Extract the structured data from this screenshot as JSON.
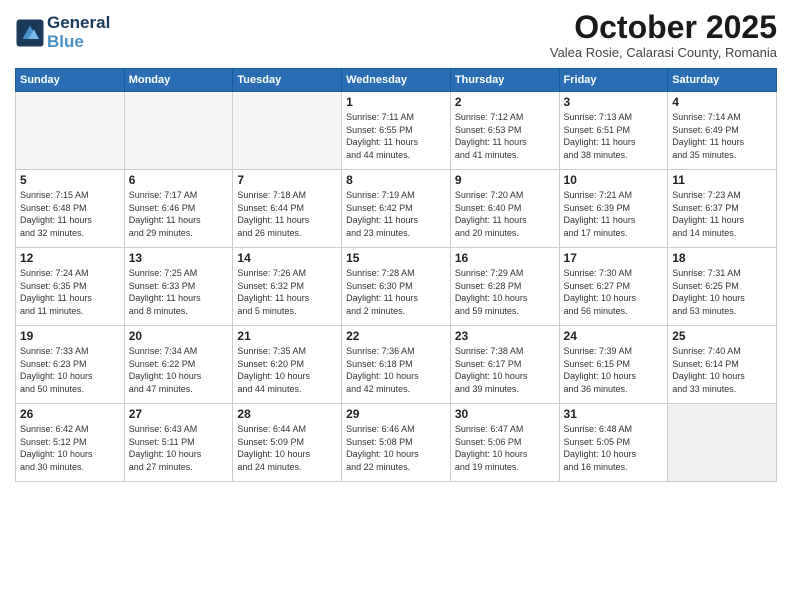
{
  "header": {
    "logo_line1": "General",
    "logo_line2": "Blue",
    "month": "October 2025",
    "location": "Valea Rosie, Calarasi County, Romania"
  },
  "days_of_week": [
    "Sunday",
    "Monday",
    "Tuesday",
    "Wednesday",
    "Thursday",
    "Friday",
    "Saturday"
  ],
  "weeks": [
    [
      {
        "day": "",
        "info": ""
      },
      {
        "day": "",
        "info": ""
      },
      {
        "day": "",
        "info": ""
      },
      {
        "day": "1",
        "info": "Sunrise: 7:11 AM\nSunset: 6:55 PM\nDaylight: 11 hours\nand 44 minutes."
      },
      {
        "day": "2",
        "info": "Sunrise: 7:12 AM\nSunset: 6:53 PM\nDaylight: 11 hours\nand 41 minutes."
      },
      {
        "day": "3",
        "info": "Sunrise: 7:13 AM\nSunset: 6:51 PM\nDaylight: 11 hours\nand 38 minutes."
      },
      {
        "day": "4",
        "info": "Sunrise: 7:14 AM\nSunset: 6:49 PM\nDaylight: 11 hours\nand 35 minutes."
      }
    ],
    [
      {
        "day": "5",
        "info": "Sunrise: 7:15 AM\nSunset: 6:48 PM\nDaylight: 11 hours\nand 32 minutes."
      },
      {
        "day": "6",
        "info": "Sunrise: 7:17 AM\nSunset: 6:46 PM\nDaylight: 11 hours\nand 29 minutes."
      },
      {
        "day": "7",
        "info": "Sunrise: 7:18 AM\nSunset: 6:44 PM\nDaylight: 11 hours\nand 26 minutes."
      },
      {
        "day": "8",
        "info": "Sunrise: 7:19 AM\nSunset: 6:42 PM\nDaylight: 11 hours\nand 23 minutes."
      },
      {
        "day": "9",
        "info": "Sunrise: 7:20 AM\nSunset: 6:40 PM\nDaylight: 11 hours\nand 20 minutes."
      },
      {
        "day": "10",
        "info": "Sunrise: 7:21 AM\nSunset: 6:39 PM\nDaylight: 11 hours\nand 17 minutes."
      },
      {
        "day": "11",
        "info": "Sunrise: 7:23 AM\nSunset: 6:37 PM\nDaylight: 11 hours\nand 14 minutes."
      }
    ],
    [
      {
        "day": "12",
        "info": "Sunrise: 7:24 AM\nSunset: 6:35 PM\nDaylight: 11 hours\nand 11 minutes."
      },
      {
        "day": "13",
        "info": "Sunrise: 7:25 AM\nSunset: 6:33 PM\nDaylight: 11 hours\nand 8 minutes."
      },
      {
        "day": "14",
        "info": "Sunrise: 7:26 AM\nSunset: 6:32 PM\nDaylight: 11 hours\nand 5 minutes."
      },
      {
        "day": "15",
        "info": "Sunrise: 7:28 AM\nSunset: 6:30 PM\nDaylight: 11 hours\nand 2 minutes."
      },
      {
        "day": "16",
        "info": "Sunrise: 7:29 AM\nSunset: 6:28 PM\nDaylight: 10 hours\nand 59 minutes."
      },
      {
        "day": "17",
        "info": "Sunrise: 7:30 AM\nSunset: 6:27 PM\nDaylight: 10 hours\nand 56 minutes."
      },
      {
        "day": "18",
        "info": "Sunrise: 7:31 AM\nSunset: 6:25 PM\nDaylight: 10 hours\nand 53 minutes."
      }
    ],
    [
      {
        "day": "19",
        "info": "Sunrise: 7:33 AM\nSunset: 6:23 PM\nDaylight: 10 hours\nand 50 minutes."
      },
      {
        "day": "20",
        "info": "Sunrise: 7:34 AM\nSunset: 6:22 PM\nDaylight: 10 hours\nand 47 minutes."
      },
      {
        "day": "21",
        "info": "Sunrise: 7:35 AM\nSunset: 6:20 PM\nDaylight: 10 hours\nand 44 minutes."
      },
      {
        "day": "22",
        "info": "Sunrise: 7:36 AM\nSunset: 6:18 PM\nDaylight: 10 hours\nand 42 minutes."
      },
      {
        "day": "23",
        "info": "Sunrise: 7:38 AM\nSunset: 6:17 PM\nDaylight: 10 hours\nand 39 minutes."
      },
      {
        "day": "24",
        "info": "Sunrise: 7:39 AM\nSunset: 6:15 PM\nDaylight: 10 hours\nand 36 minutes."
      },
      {
        "day": "25",
        "info": "Sunrise: 7:40 AM\nSunset: 6:14 PM\nDaylight: 10 hours\nand 33 minutes."
      }
    ],
    [
      {
        "day": "26",
        "info": "Sunrise: 6:42 AM\nSunset: 5:12 PM\nDaylight: 10 hours\nand 30 minutes."
      },
      {
        "day": "27",
        "info": "Sunrise: 6:43 AM\nSunset: 5:11 PM\nDaylight: 10 hours\nand 27 minutes."
      },
      {
        "day": "28",
        "info": "Sunrise: 6:44 AM\nSunset: 5:09 PM\nDaylight: 10 hours\nand 24 minutes."
      },
      {
        "day": "29",
        "info": "Sunrise: 6:46 AM\nSunset: 5:08 PM\nDaylight: 10 hours\nand 22 minutes."
      },
      {
        "day": "30",
        "info": "Sunrise: 6:47 AM\nSunset: 5:06 PM\nDaylight: 10 hours\nand 19 minutes."
      },
      {
        "day": "31",
        "info": "Sunrise: 6:48 AM\nSunset: 5:05 PM\nDaylight: 10 hours\nand 16 minutes."
      },
      {
        "day": "",
        "info": ""
      }
    ]
  ]
}
